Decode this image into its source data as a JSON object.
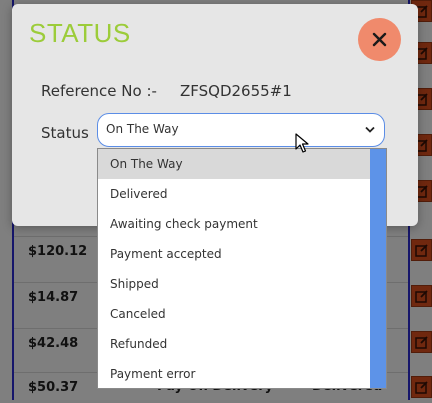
{
  "background_orders": {
    "rows": [
      {
        "price": "$120.12"
      },
      {
        "price": "$14.87"
      },
      {
        "price": "$42.48"
      },
      {
        "price": "$50.37"
      }
    ],
    "last_row_payment": "Pay On Delivery",
    "last_row_status": "Delivered"
  },
  "modal": {
    "title": "STATUS",
    "reference_label": "Reference No :-",
    "reference_value": "ZFSQD2655#1",
    "status_label": "Status",
    "status_selected": "On The Way",
    "status_options": [
      "On The Way",
      "Delivered",
      "Awaiting check payment",
      "Payment accepted",
      "Shipped",
      "Canceled",
      "Refunded",
      "Payment error"
    ]
  },
  "colors": {
    "title": "#9ccc3a",
    "close_button": "#f08a6c",
    "select_border": "#5b8de6",
    "scrollbar": "#5d93e8",
    "edit_button": "#e0501e"
  },
  "icons": {
    "close": "close-icon",
    "chevron": "chevron-down-icon",
    "edit": "edit-icon",
    "cursor": "mouse-cursor-icon"
  }
}
